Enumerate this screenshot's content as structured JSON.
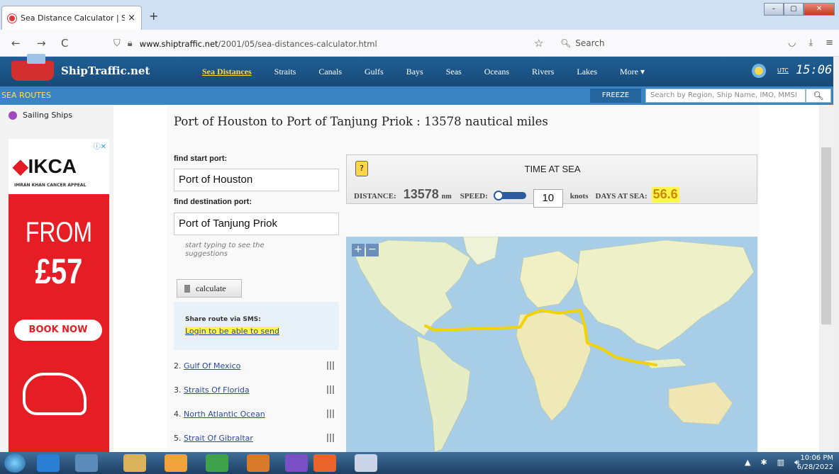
{
  "browser": {
    "tab_title": "Sea Distance Calculator | ShipTra",
    "tab_close": "×",
    "new_tab": "+",
    "url_host": "www.shiptraffic.net",
    "url_path": "/2001/05/sea-distances-calculator.html",
    "search_placeholder": "Search",
    "back": "←",
    "forward": "→",
    "reload": "C"
  },
  "site": {
    "brand": "ShipTraffic.net",
    "menu": [
      "Sea Distances",
      "Straits",
      "Canals",
      "Gulfs",
      "Bays",
      "Seas",
      "Oceans",
      "Rivers",
      "Lakes",
      "More ▾"
    ],
    "utc_label": "UTC",
    "clock": "15:06",
    "subbar_label": "SEA ROUTES",
    "freeze": "FREEZE",
    "site_search_placeholder": "Search by Region, Ship Name, IMO, MMSI"
  },
  "sidebar": {
    "sailing_ships": "Sailing Ships",
    "ad": {
      "brand": "IKCA",
      "sub": "IMRAN KHAN CANCER APPEAL",
      "from": "FROM",
      "price": "£57",
      "cta": "BOOK NOW"
    }
  },
  "main": {
    "heading": "Port of Houston to Port of Tanjung Priok : 13578 nautical miles",
    "start_label": "find start port:",
    "start_value": "Port of Houston",
    "dest_label": "find destination port:",
    "dest_value": "Port of Tanjung Priok",
    "hint": "start typing to see the suggestions",
    "calculate": "calculate",
    "sms_title": "Share route via SMS:",
    "sms_link": "Login to be able to send",
    "route": [
      {
        "num": "2.",
        "name": "Gulf Of Mexico"
      },
      {
        "num": "3.",
        "name": "Straits Of Florida"
      },
      {
        "num": "4.",
        "name": "North Atlantic Ocean"
      },
      {
        "num": "5.",
        "name": "Strait Of Gibraltar"
      }
    ]
  },
  "time_at_sea": {
    "badge": "?",
    "title": "TIME AT SEA",
    "distance_label": "DISTANCE:",
    "distance": "13578",
    "distance_unit": "nm",
    "speed_label": "SPEED:",
    "speed": "10",
    "knots_label": "knots",
    "days_label": "DAYS AT SEA:",
    "days": "56.6"
  },
  "map": {
    "zoom_in": "+",
    "zoom_out": "−"
  },
  "taskbar": {
    "time": "10:06 PM",
    "date": "6/28/2022"
  },
  "colors": {
    "header": "#1f5f95",
    "subbar": "#3a84c3",
    "route": "#f2d200",
    "highlight": "#fff34d"
  }
}
